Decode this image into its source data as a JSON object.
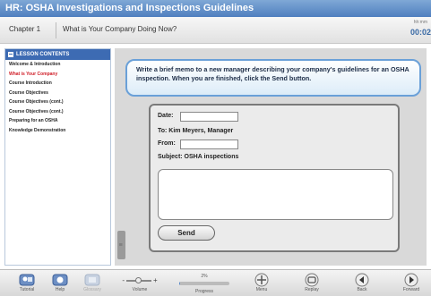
{
  "title_bar": {
    "title": "HR: OSHA Investigations and Inspections Guidelines"
  },
  "chapter_bar": {
    "chapter": "Chapter 1",
    "title": "What is Your Company Doing Now?",
    "timer_label": "hh:mm",
    "timer_value": "00:02"
  },
  "lesson_contents": {
    "header": "LESSON CONTENTS",
    "items": [
      {
        "label": "Welcome & Introduction",
        "active": false
      },
      {
        "label": "What is Your Company",
        "active": true
      },
      {
        "label": "Course Introduction",
        "active": false
      },
      {
        "label": "Course Objectives",
        "active": false
      },
      {
        "label": "Course Objectives (cont.)",
        "active": false
      },
      {
        "label": "Course Objectives (cont.)",
        "active": false
      },
      {
        "label": "Preparing for an OSHA",
        "active": false
      },
      {
        "label": "Knowledge Demonstration",
        "active": false
      }
    ]
  },
  "instruction": "Write a brief memo to a new manager describing your company's guidelines for an OSHA inspection. When you are finished, click the Send button.",
  "memo": {
    "date_label": "Date:",
    "date_value": "",
    "to_label": "To: Kim Meyers, Manager",
    "from_label": "From:",
    "from_value": "",
    "subject_label": "Subject: OSHA inspections",
    "body_value": "",
    "send_label": "Send"
  },
  "toolbar": {
    "tutorial": "Tutorial",
    "help": "Help",
    "glossary": "Glossary",
    "volume_label": "Volume",
    "progress_pct": "2%",
    "progress_value": 0.02,
    "progress_label": "Progress",
    "menu": "Menu",
    "replay": "Replay",
    "back": "Back",
    "forward": "Forward"
  },
  "colors": {
    "title_bar": "#4f7fbf",
    "active_lesson": "#d0202a",
    "instruction_border": "#6aa0d8",
    "timer": "#3a6aa5"
  }
}
